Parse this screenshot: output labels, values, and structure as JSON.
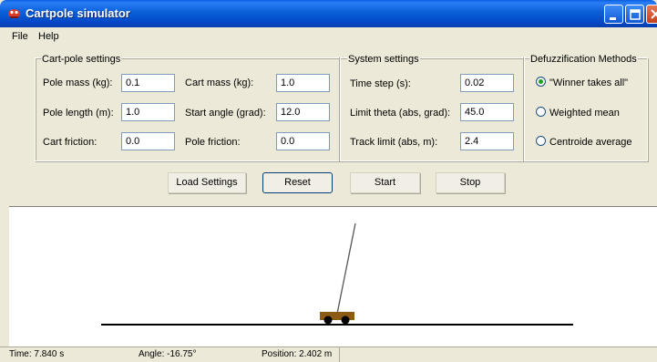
{
  "window": {
    "title": "Cartpole simulator"
  },
  "menu": [
    "File",
    "Help"
  ],
  "cartpole_settings": {
    "title": "Cart-pole settings",
    "pole_mass": {
      "label": "Pole mass (kg):",
      "value": "0.1"
    },
    "cart_mass": {
      "label": "Cart mass (kg):",
      "value": "1.0"
    },
    "pole_length": {
      "label": "Pole length (m):",
      "value": "1.0"
    },
    "start_angle": {
      "label": "Start angle (grad):",
      "value": "12.0"
    },
    "cart_friction": {
      "label": "Cart friction:",
      "value": "0.0"
    },
    "pole_friction": {
      "label": "Pole friction:",
      "value": "0.0"
    }
  },
  "system_settings": {
    "title": "System settings",
    "time_step": {
      "label": "Time step (s):",
      "value": "0.02"
    },
    "limit_theta": {
      "label": "Limit theta (abs, grad):",
      "value": "45.0"
    },
    "track_limit": {
      "label": "Track limit (abs, m):",
      "value": "2.4"
    }
  },
  "defuzzification": {
    "title": "Defuzzification Methods",
    "options": [
      {
        "label": "\"Winner takes all\"",
        "selected": true
      },
      {
        "label": "Weighted mean",
        "selected": false
      },
      {
        "label": "Centroide average",
        "selected": false
      }
    ]
  },
  "buttons": {
    "load_settings": "Load Settings",
    "reset": "Reset",
    "start": "Start",
    "stop": "Stop"
  },
  "status": {
    "time": "Time: 7.840 s",
    "angle": "Angle: -16.75°",
    "position": "Position: 2.402 m"
  },
  "colors": {
    "titlebar": "#0a5fd8",
    "cart": "#8b5a14",
    "wheels": "#000000"
  }
}
